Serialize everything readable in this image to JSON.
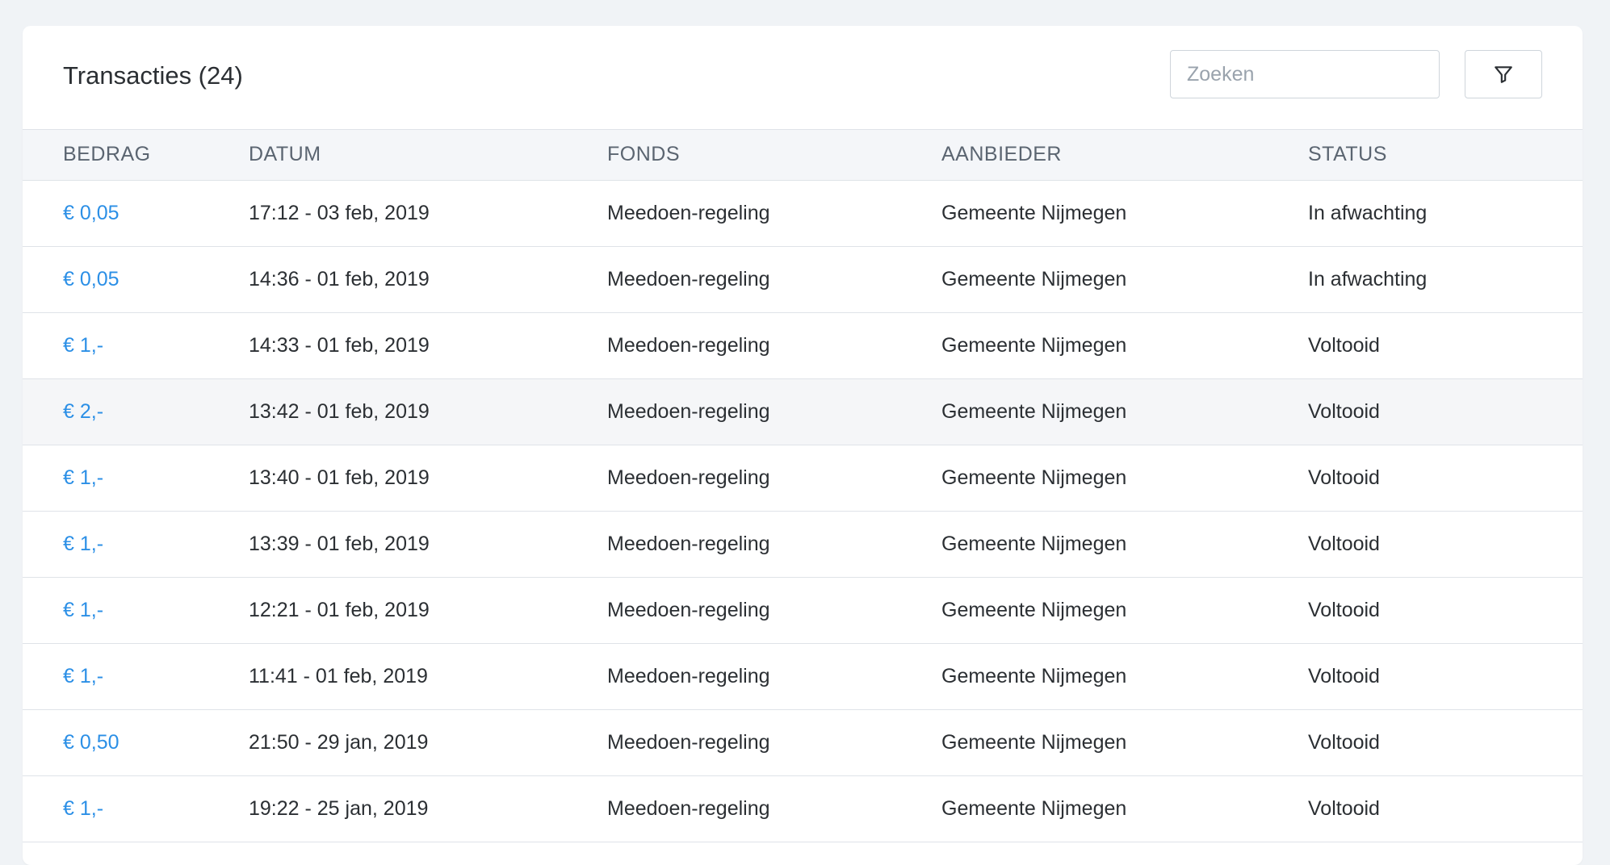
{
  "header": {
    "title": "Transacties (24)",
    "search_placeholder": "Zoeken",
    "filter_icon": "filter-icon"
  },
  "table": {
    "columns": [
      "BEDRAG",
      "DATUM",
      "FONDS",
      "AANBIEDER",
      "STATUS"
    ],
    "rows": [
      {
        "amount": "€ 0,05",
        "date": "17:12 - 03 feb, 2019",
        "fund": "Meedoen-regeling",
        "provider": "Gemeente Nijmegen",
        "status": "In afwachting"
      },
      {
        "amount": "€ 0,05",
        "date": "14:36 - 01 feb, 2019",
        "fund": "Meedoen-regeling",
        "provider": "Gemeente Nijmegen",
        "status": "In afwachting"
      },
      {
        "amount": "€ 1,-",
        "date": "14:33 - 01 feb, 2019",
        "fund": "Meedoen-regeling",
        "provider": "Gemeente Nijmegen",
        "status": "Voltooid"
      },
      {
        "amount": "€ 2,-",
        "date": "13:42 - 01 feb, 2019",
        "fund": "Meedoen-regeling",
        "provider": "Gemeente Nijmegen",
        "status": "Voltooid"
      },
      {
        "amount": "€ 1,-",
        "date": "13:40 - 01 feb, 2019",
        "fund": "Meedoen-regeling",
        "provider": "Gemeente Nijmegen",
        "status": "Voltooid"
      },
      {
        "amount": "€ 1,-",
        "date": "13:39 - 01 feb, 2019",
        "fund": "Meedoen-regeling",
        "provider": "Gemeente Nijmegen",
        "status": "Voltooid"
      },
      {
        "amount": "€ 1,-",
        "date": "12:21 - 01 feb, 2019",
        "fund": "Meedoen-regeling",
        "provider": "Gemeente Nijmegen",
        "status": "Voltooid"
      },
      {
        "amount": "€ 1,-",
        "date": "11:41 - 01 feb, 2019",
        "fund": "Meedoen-regeling",
        "provider": "Gemeente Nijmegen",
        "status": "Voltooid"
      },
      {
        "amount": "€ 0,50",
        "date": "21:50 - 29 jan, 2019",
        "fund": "Meedoen-regeling",
        "provider": "Gemeente Nijmegen",
        "status": "Voltooid"
      },
      {
        "amount": "€ 1,-",
        "date": "19:22 - 25 jan, 2019",
        "fund": "Meedoen-regeling",
        "provider": "Gemeente Nijmegen",
        "status": "Voltooid"
      }
    ]
  },
  "colors": {
    "accent": "#2b8fe6",
    "background": "#f0f3f6",
    "header_row": "#f4f6f9",
    "hover_row": "#f5f6f8"
  }
}
